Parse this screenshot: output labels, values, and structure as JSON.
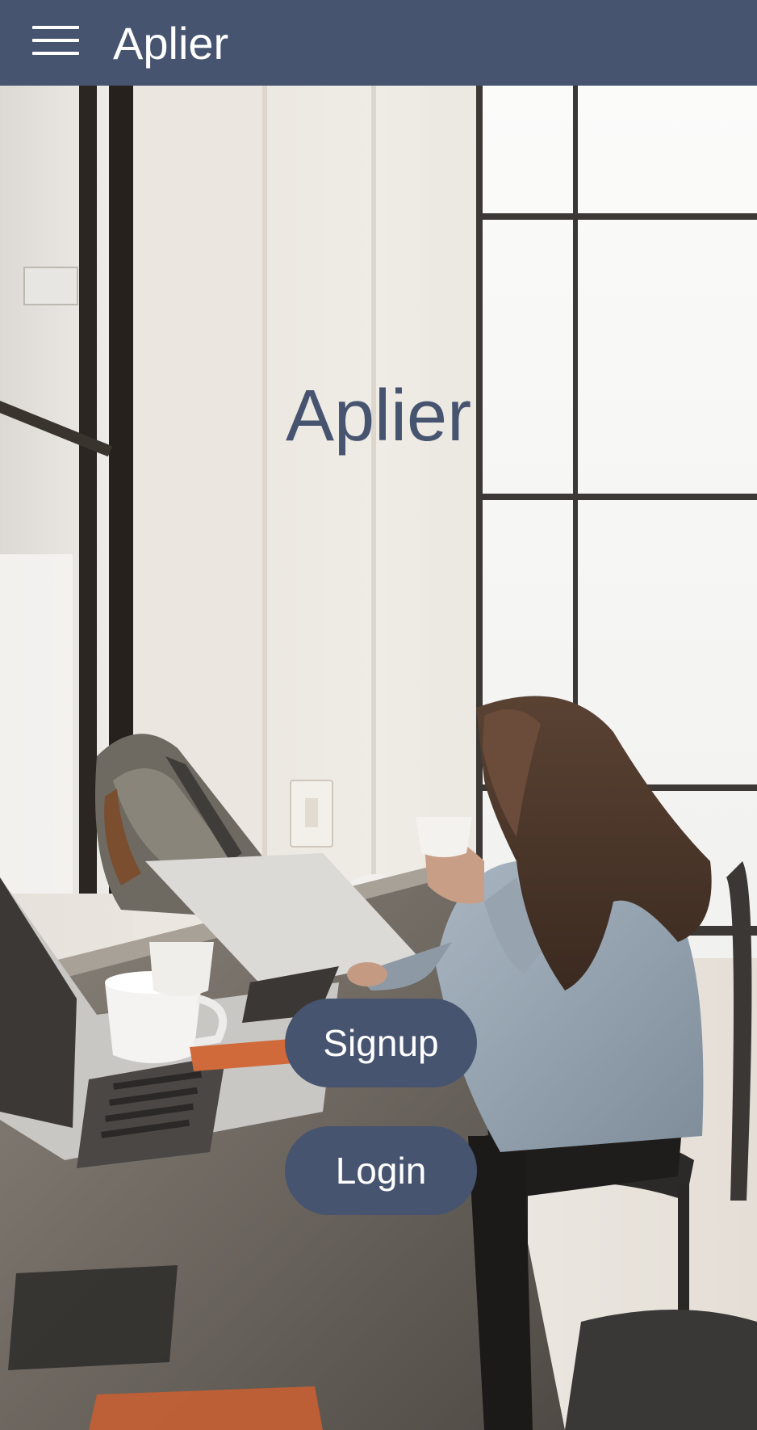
{
  "app_bar": {
    "title": "Aplier",
    "menu_icon": "hamburger-menu-icon"
  },
  "hero": {
    "title": "Aplier",
    "background": "photo: woman with coffee cup at laptop by window"
  },
  "actions": {
    "signup_label": "Signup",
    "login_label": "Login"
  },
  "colors": {
    "primary": "#465470",
    "on_primary": "#ffffff"
  }
}
